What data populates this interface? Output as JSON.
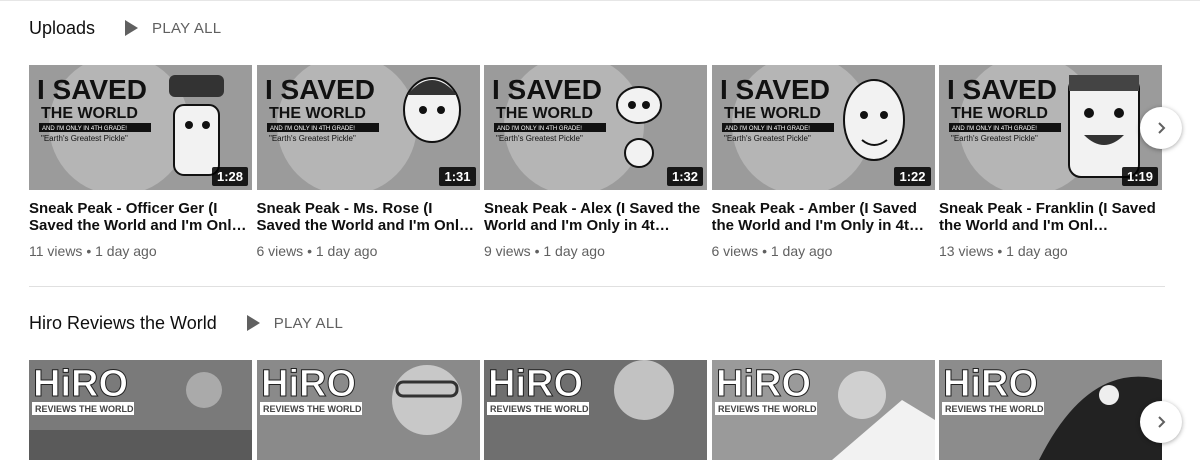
{
  "shelves": [
    {
      "title": "Uploads",
      "play_all": "PLAY ALL",
      "videos": [
        {
          "title": "Sneak Peak - Officer Ger (I Saved the World and I'm Onl…",
          "duration": "1:28",
          "views": "11 views",
          "age": "1 day ago",
          "thumb_title": "I SAVED",
          "thumb_sub": "THE WORLD",
          "thumb_strip": "AND I'M ONLY IN 4TH GRADE!",
          "thumb_episode": "\"Earth's Greatest Pickle\""
        },
        {
          "title": "Sneak Peak - Ms. Rose (I Saved the World and I'm Onl…",
          "duration": "1:31",
          "views": "6 views",
          "age": "1 day ago",
          "thumb_title": "I SAVED",
          "thumb_sub": "THE WORLD",
          "thumb_strip": "AND I'M ONLY IN 4TH GRADE!",
          "thumb_episode": "\"Earth's Greatest Pickle\""
        },
        {
          "title": "Sneak Peak - Alex (I Saved the World and I'm Only in 4t…",
          "duration": "1:32",
          "views": "9 views",
          "age": "1 day ago",
          "thumb_title": "I SAVED",
          "thumb_sub": "THE WORLD",
          "thumb_strip": "AND I'M ONLY IN 4TH GRADE!",
          "thumb_episode": "\"Earth's Greatest Pickle\""
        },
        {
          "title": "Sneak Peak - Amber (I Saved the World and I'm Only in 4t…",
          "duration": "1:22",
          "views": "6 views",
          "age": "1 day ago",
          "thumb_title": "I SAVED",
          "thumb_sub": "THE WORLD",
          "thumb_strip": "AND I'M ONLY IN 4TH GRADE!",
          "thumb_episode": "\"Earth's Greatest Pickle\""
        },
        {
          "title": "Sneak Peak - Franklin (I Saved the World and I'm Onl…",
          "duration": "1:19",
          "views": "13 views",
          "age": "1 day ago",
          "thumb_title": "I SAVED",
          "thumb_sub": "THE WORLD",
          "thumb_strip": "AND I'M ONLY IN 4TH GRADE!",
          "thumb_episode": "\"Earth's Greatest Pickle\""
        }
      ]
    },
    {
      "title": "Hiro Reviews the World",
      "play_all": "PLAY ALL",
      "videos": [
        {
          "thumb_logo": "HiRO",
          "thumb_tag": "REVIEWS THE WORLD"
        },
        {
          "thumb_logo": "HiRO",
          "thumb_tag": "REVIEWS THE WORLD"
        },
        {
          "thumb_logo": "HiRO",
          "thumb_tag": "REVIEWS THE WORLD"
        },
        {
          "thumb_logo": "HiRO",
          "thumb_tag": "REVIEWS THE WORLD"
        },
        {
          "thumb_logo": "HiRO",
          "thumb_tag": "REVIEWS THE WORLD"
        }
      ]
    }
  ],
  "meta_separator": "•",
  "icons": {
    "play": "play-icon",
    "next": "chevron-right-icon"
  },
  "colors": {
    "title": "#0f0f0f",
    "secondary": "#606060",
    "divider": "#e0e0e0"
  }
}
